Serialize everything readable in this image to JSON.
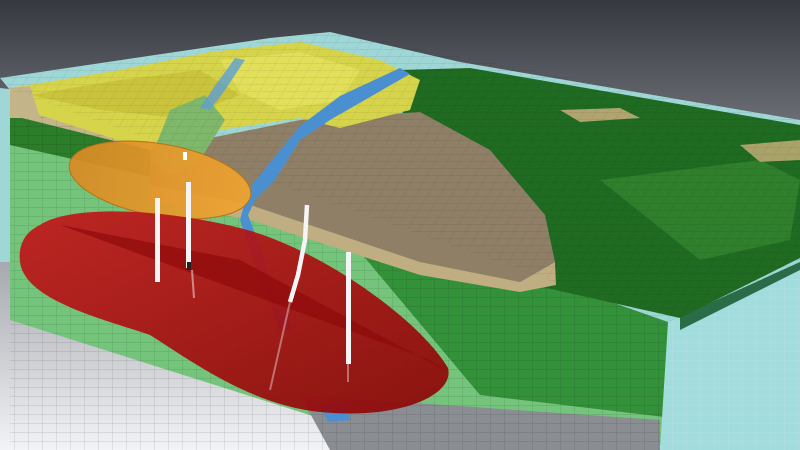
{
  "scene": {
    "description_visible_text": [],
    "colors": {
      "background_top": "#3a3d44",
      "background_bottom": "#f2f3f6",
      "water_layer": "#9fd6d6",
      "topsoil_tan": "#b9a77d",
      "dark_green_layer": "#1f6b22",
      "mid_green_layer": "#2f8a2f",
      "light_green_layer": "#7fcf84",
      "gray_basement": "#8a8d92",
      "yellow_surface": "#d6d44a",
      "river_blue": "#4a8fd0",
      "brown_plain": "#8f7f66",
      "orange_lens": "#e89a2a",
      "red_plume": "#b20f12",
      "well_white": "#f5f5f5"
    },
    "icons": []
  }
}
